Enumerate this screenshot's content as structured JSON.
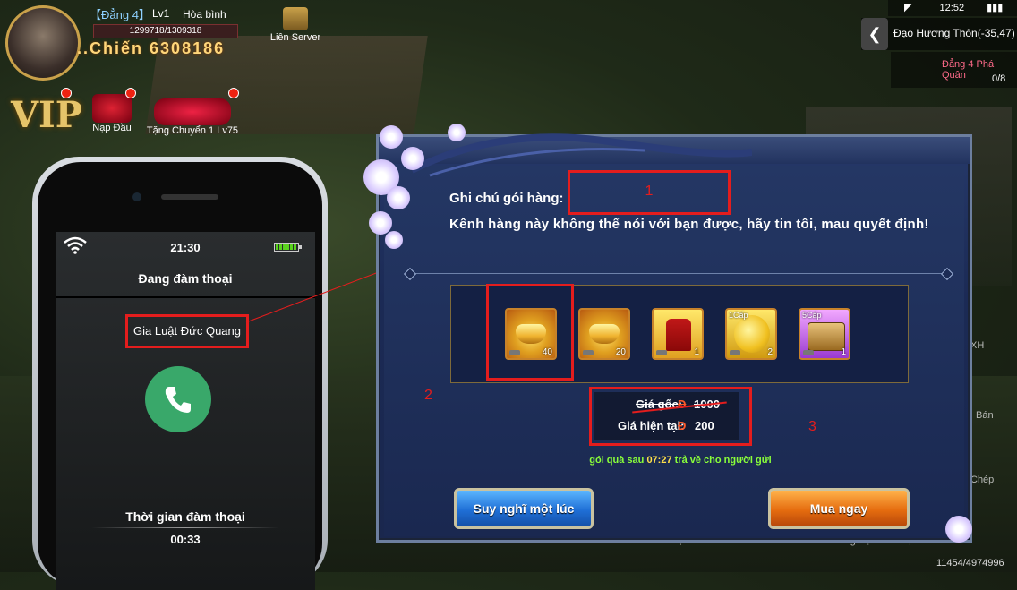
{
  "hud": {
    "player_name": "【Đẳng 4】",
    "level": "Lv1",
    "peace_mode": "Hòa bình",
    "exp_text": "1299718/1309318",
    "power_label": "..Chiến",
    "power_value": "6308186",
    "server_label": "Liên Server",
    "vip_label": "VIP",
    "recharge_label": "Nạp Đầu",
    "gift_label": "Tặng Chuyển 1 Lv75"
  },
  "status_bar": {
    "time": "12:52"
  },
  "location": {
    "text": "Đạo Hương Thôn(-35,47)"
  },
  "quest": {
    "title": "Đẳng 4 Phá Quân",
    "progress": "0/8"
  },
  "phone": {
    "time": "21:30",
    "call_status": "Đang đàm thoại",
    "caller_name": "Gia Luật Đức Quang",
    "duration_label": "Thời gian đàm thoại",
    "duration": "00:33"
  },
  "dialog": {
    "note_label": "Ghi chú gói hàng:",
    "note_description": "Kênh hàng này không thể nói với bạn được, hãy tin tôi, mau quyết định!",
    "items": [
      {
        "name": "gold-ingot-icon",
        "qty": "40"
      },
      {
        "name": "gold-ingot-icon",
        "qty": "20"
      },
      {
        "name": "costume-icon",
        "qty": "1"
      },
      {
        "name": "gold-coin-icon",
        "qty": "2",
        "badge": "1Cấp"
      },
      {
        "name": "treasure-chest-icon",
        "qty": "1",
        "badge": "5Cấp"
      }
    ],
    "original_price_label": "Giá gốc:",
    "original_price": "1000",
    "current_price_label": "Giá hiện tại:",
    "current_price": "200",
    "currency_symbol": "Đ",
    "timer_prefix": "gói quà sau",
    "timer_value": "07:27",
    "timer_suffix": "trả về cho người gửi",
    "think_button": "Suy nghĩ một lúc",
    "buy_button": "Mua ngay"
  },
  "annotations": {
    "label_1": "1",
    "label_2": "2",
    "label_3": "3",
    "highlight_color": "#e41d1d"
  },
  "bottom_menu": [
    "Cài Đặt",
    "Linh Luân",
    "Phê",
    "Bang Hội",
    "Bạn"
  ],
  "right_menu": [
    "XH",
    "Bán",
    "Chép"
  ],
  "counter": "11454/4974996"
}
